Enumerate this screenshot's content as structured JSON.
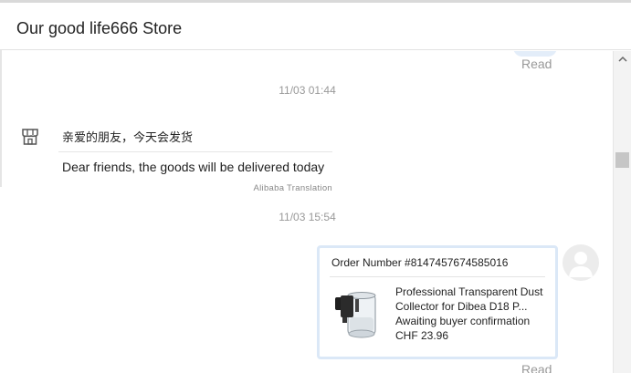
{
  "header": {
    "title": "Our good life666 Store"
  },
  "messages": {
    "read_label_1": "Read",
    "read_label_2": "Read",
    "timestamp_1": "11/03 01:44",
    "timestamp_2": "11/03 15:54",
    "incoming": {
      "icon": "store-icon",
      "original": "亲爱的朋友，今天会发货",
      "translation": "Dear friends, the goods will be delivered today",
      "translation_credit": "Alibaba Translation"
    },
    "order_card": {
      "order_number": "Order Number #8147457674585016",
      "product_title": "Professional Transparent Dust Collector for Dibea D18 P...",
      "status": "Awaiting buyer confirmation",
      "price": "CHF 23.96",
      "image": "dust-collector-product-image"
    },
    "avatar": "user-avatar-icon"
  },
  "colors": {
    "bubble_border": "#dbe8f7",
    "muted_text": "#999999",
    "scroll_thumb": "#c6c6c6"
  }
}
